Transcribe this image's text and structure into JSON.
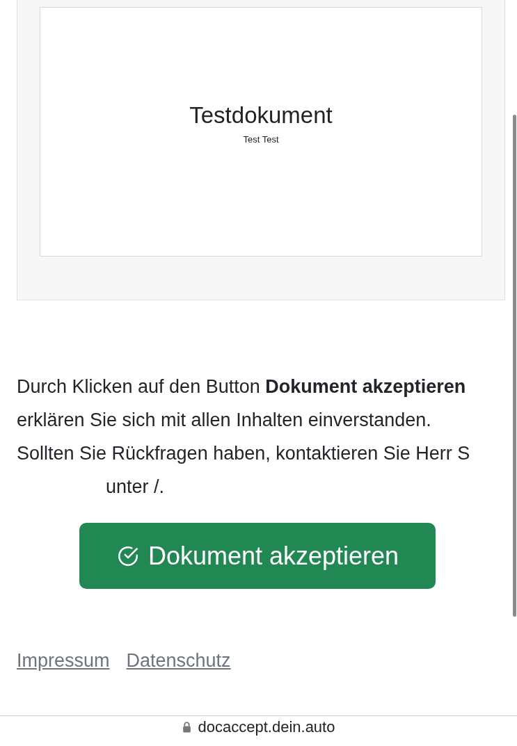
{
  "document_preview": {
    "title": "Testdokument",
    "subtitle": "Test Test"
  },
  "notice": {
    "text": "Durch Klicken auf den Button **Dokument akzeptieren** erklären Sie sich mit allen Inhalten einverstanden. Sollten Sie Rückfragen haben, kontaktieren Sie Herr S",
    "text_after": "unter /."
  },
  "accept_button": {
    "label": "Dokument akzeptieren"
  },
  "footer_links": [
    "Impressum",
    "Datenschutz"
  ],
  "address_bar": {
    "url": "docaccept.dein.auto"
  }
}
